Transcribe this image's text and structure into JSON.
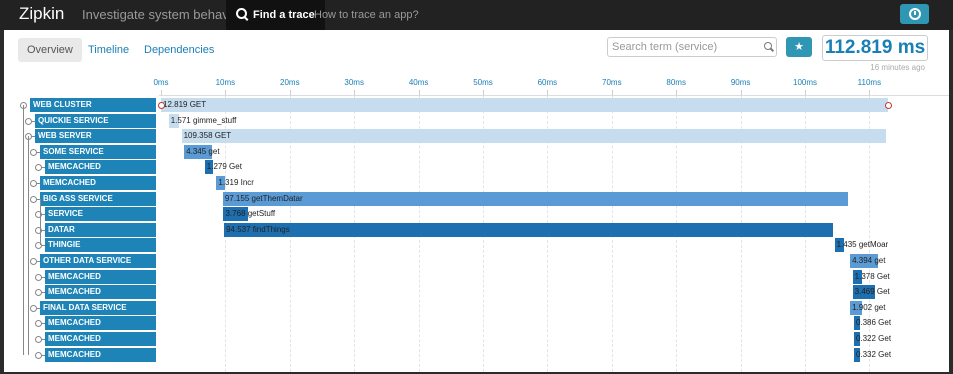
{
  "navbar": {
    "brand": "Zipkin",
    "tagline": "Investigate system behavior",
    "find_trace": "Find a trace",
    "how_to": "How to trace an app?",
    "clock_icon": "clock-icon"
  },
  "tabs": [
    "Overview",
    "Timeline",
    "Dependencies"
  ],
  "search": {
    "placeholder": "Search term (service)",
    "icon": "search-icon"
  },
  "star_icon": "star-icon",
  "duration": "112.819 ms",
  "ago": "16 minutes ago",
  "timeline": {
    "ticks": [
      "0ms",
      "10ms",
      "20ms",
      "30ms",
      "40ms",
      "50ms",
      "60ms",
      "70ms",
      "80ms",
      "90ms",
      "100ms",
      "110ms"
    ],
    "total_ms": 112.819,
    "tick_step_ms": 10
  },
  "spans": [
    {
      "service": "WEB CLUSTER",
      "depth": 0,
      "start_ms": 0,
      "duration_ms": 112.819,
      "label": "12.819 GET",
      "color": "#c6dcef"
    },
    {
      "service": "QUICKIE SERVICE",
      "depth": 1,
      "start_ms": 1.2,
      "duration_ms": 1.571,
      "label": "1.571 gimme_stuff",
      "color": "#c6dcef"
    },
    {
      "service": "WEB SERVER",
      "depth": 1,
      "start_ms": 3.2,
      "duration_ms": 109.358,
      "label": "109.358 GET",
      "color": "#c6dcef"
    },
    {
      "service": "SOME SERVICE",
      "depth": 2,
      "start_ms": 3.6,
      "duration_ms": 4.345,
      "label": "4.345 get",
      "color": "#5b9bd5"
    },
    {
      "service": "MEMCACHED",
      "depth": 3,
      "start_ms": 6.8,
      "duration_ms": 1.279,
      "label": "1.279 Get",
      "color": "#1e6fb0"
    },
    {
      "service": "MEMCACHED",
      "depth": 2,
      "start_ms": 8.6,
      "duration_ms": 1.319,
      "label": "1.319 Incr",
      "color": "#5b9bd5"
    },
    {
      "service": "BIG ASS SERVICE",
      "depth": 2,
      "start_ms": 9.6,
      "duration_ms": 97.155,
      "label": "97.155 getThemDatar",
      "color": "#5b9bd5"
    },
    {
      "service": "SERVICE",
      "depth": 3,
      "start_ms": 9.7,
      "duration_ms": 3.768,
      "label": "3.768 getStuff",
      "color": "#1e6fb0"
    },
    {
      "service": "DATAR",
      "depth": 3,
      "start_ms": 9.8,
      "duration_ms": 94.537,
      "label": "94.537 findThings",
      "color": "#1e6fb0"
    },
    {
      "service": "THINGIE",
      "depth": 3,
      "start_ms": 104.6,
      "duration_ms": 1.435,
      "label": "1.435 getMoar",
      "color": "#1e6fb0"
    },
    {
      "service": "OTHER DATA SERVICE",
      "depth": 2,
      "start_ms": 107.0,
      "duration_ms": 4.394,
      "label": "4.394 get",
      "color": "#5b9bd5"
    },
    {
      "service": "MEMCACHED",
      "depth": 3,
      "start_ms": 107.4,
      "duration_ms": 1.378,
      "label": "1.378 Get",
      "color": "#1e6fb0"
    },
    {
      "service": "MEMCACHED",
      "depth": 3,
      "start_ms": 107.4,
      "duration_ms": 3.469,
      "label": "3.469 Get",
      "color": "#1e6fb0"
    },
    {
      "service": "FINAL DATA SERVICE",
      "depth": 2,
      "start_ms": 107.0,
      "duration_ms": 1.902,
      "label": "1.902 get",
      "color": "#5b9bd5"
    },
    {
      "service": "MEMCACHED",
      "depth": 3,
      "start_ms": 107.6,
      "duration_ms": 0.386,
      "label": "0.386 Get",
      "color": "#1e6fb0"
    },
    {
      "service": "MEMCACHED",
      "depth": 3,
      "start_ms": 107.6,
      "duration_ms": 0.322,
      "label": "0.322 Get",
      "color": "#1e6fb0"
    },
    {
      "service": "MEMCACHED",
      "depth": 3,
      "start_ms": 107.6,
      "duration_ms": 0.332,
      "label": "0.332 Get",
      "color": "#1e6fb0"
    }
  ]
}
